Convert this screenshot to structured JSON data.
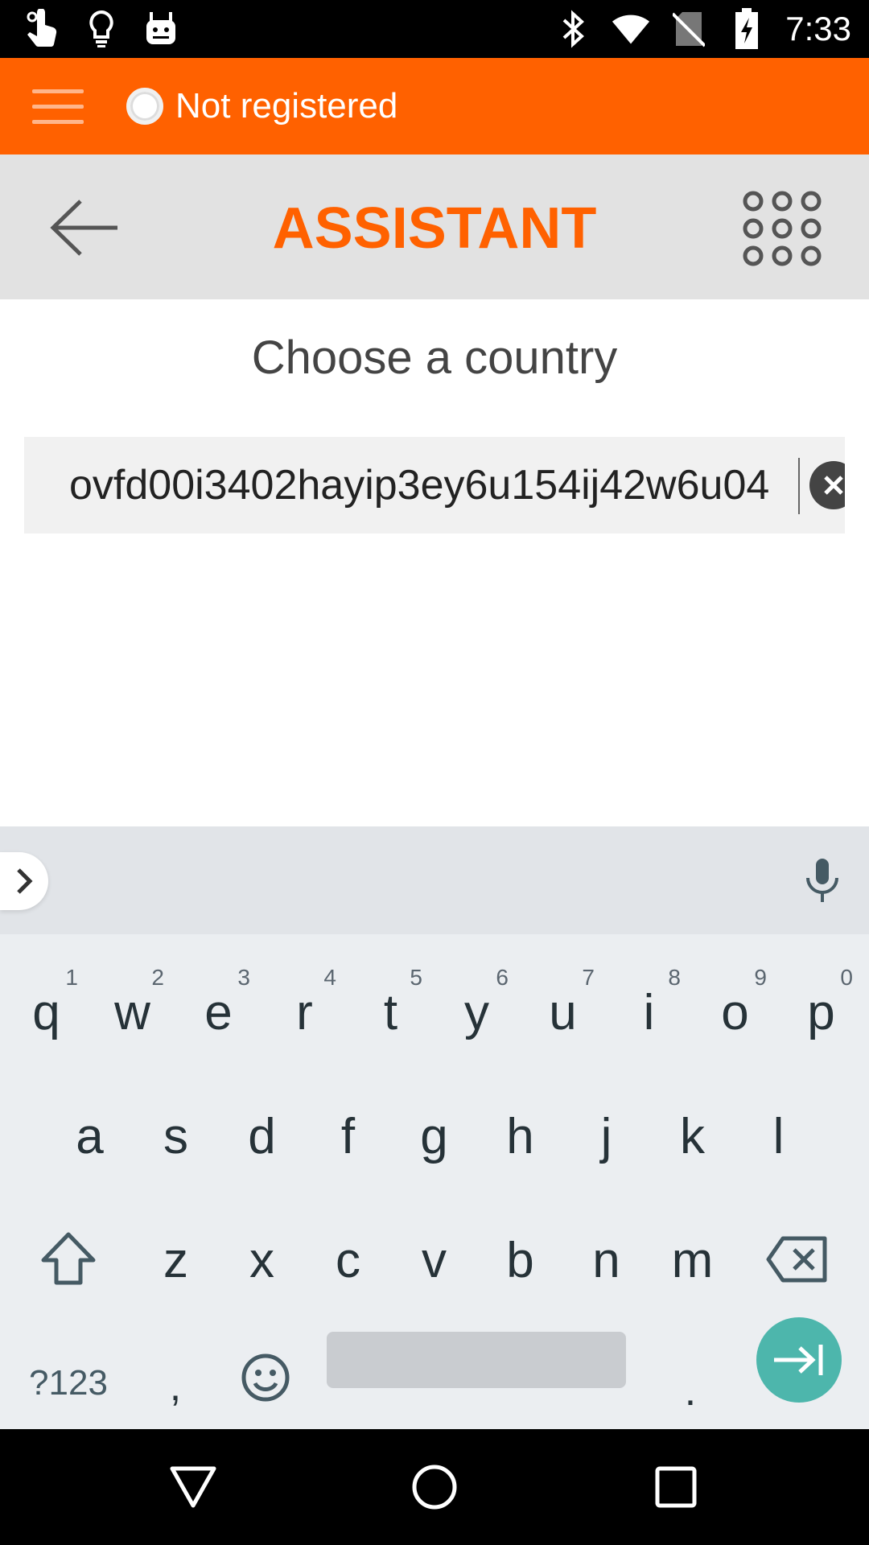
{
  "status_bar": {
    "time": "7:33",
    "left_icons": [
      "touch-gesture-icon",
      "lightbulb-icon",
      "android-bot-icon"
    ],
    "right_icons": [
      "bluetooth-icon",
      "wifi-icon",
      "no-sim-icon",
      "battery-charging-icon"
    ]
  },
  "app_bar": {
    "menu_icon": "hamburger-menu-icon",
    "registration_status": "Not registered",
    "background_color": "#ff6100"
  },
  "top_bar": {
    "back_icon": "arrow-left-icon",
    "title": "ASSISTANT",
    "dialer_icon": "dialpad-icon",
    "title_color": "#ff6100"
  },
  "content": {
    "subtitle": "Choose a country",
    "search": {
      "value": "ovfd00i3402hayip3ey6u154ij42w6u04",
      "clear_icon": "clear-icon"
    }
  },
  "keyboard": {
    "row1": [
      {
        "key": "q",
        "hint": "1"
      },
      {
        "key": "w",
        "hint": "2"
      },
      {
        "key": "e",
        "hint": "3"
      },
      {
        "key": "r",
        "hint": "4"
      },
      {
        "key": "t",
        "hint": "5"
      },
      {
        "key": "y",
        "hint": "6"
      },
      {
        "key": "u",
        "hint": "7"
      },
      {
        "key": "i",
        "hint": "8"
      },
      {
        "key": "o",
        "hint": "9"
      },
      {
        "key": "p",
        "hint": "0"
      }
    ],
    "row2": [
      "a",
      "s",
      "d",
      "f",
      "g",
      "h",
      "j",
      "k",
      "l"
    ],
    "row3": [
      "z",
      "x",
      "c",
      "v",
      "b",
      "n",
      "m"
    ],
    "symbols_label": "?123",
    "comma_label": ",",
    "period_label": ".",
    "accent_color": "#4db6ac"
  },
  "nav_bar": {
    "icons": [
      "back-triangle-icon",
      "home-circle-icon",
      "recents-square-icon"
    ]
  }
}
